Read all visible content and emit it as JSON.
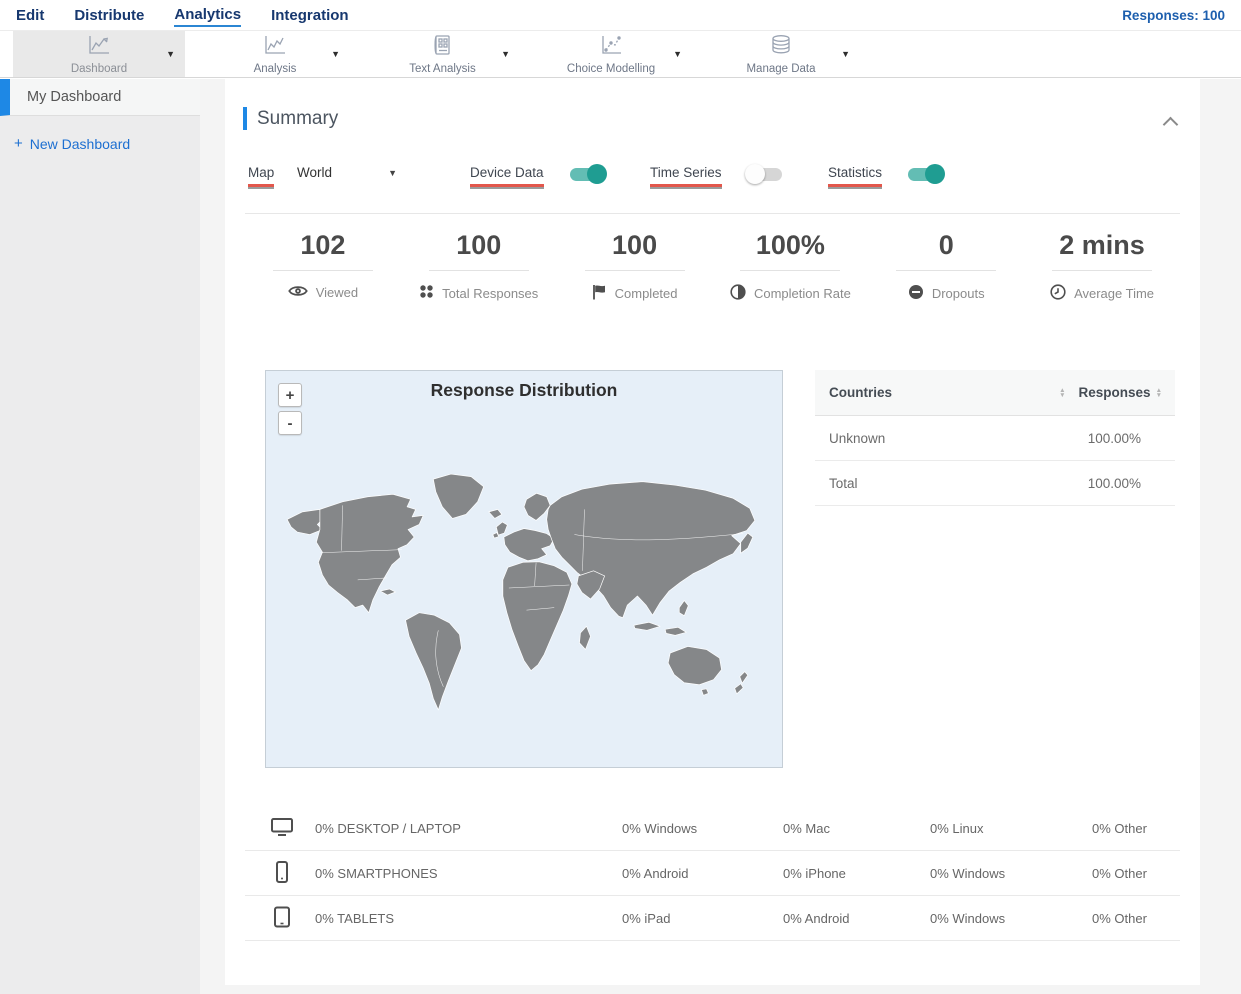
{
  "colors": {
    "accent_blue": "#1e88e5",
    "nav_text": "#17386f",
    "nav_underline": "#2b86d3",
    "link_blue": "#1d6fd1",
    "toggle_on_teal": "#26a69a",
    "label_underline_red": "#e2574c",
    "map_background": "#e6eff8",
    "map_country_fill": "#858789"
  },
  "top_nav": {
    "items": [
      {
        "label": "Edit",
        "active": false
      },
      {
        "label": "Distribute",
        "active": false
      },
      {
        "label": "Analytics",
        "active": true
      },
      {
        "label": "Integration",
        "active": false
      }
    ],
    "responses_label": "Responses: 100"
  },
  "toolbar": {
    "items": [
      {
        "label": "Dashboard",
        "icon": "line-chart-icon",
        "active": true
      },
      {
        "label": "Analysis",
        "icon": "line-chart-icon",
        "active": false
      },
      {
        "label": "Text Analysis",
        "icon": "document-grid-icon",
        "active": false
      },
      {
        "label": "Choice Modelling",
        "icon": "scatter-chart-icon",
        "active": false
      },
      {
        "label": "Manage Data",
        "icon": "database-icon",
        "active": false
      }
    ]
  },
  "sidebar": {
    "items": [
      {
        "label": "My Dashboard",
        "active": true
      }
    ],
    "new_dashboard": {
      "plus": "+",
      "label": "New Dashboard"
    }
  },
  "summary": {
    "title": "Summary",
    "controls": {
      "map_label": "Map",
      "map_region": "World",
      "toggles": [
        {
          "label": "Device Data",
          "on": true
        },
        {
          "label": "Time Series",
          "on": false
        },
        {
          "label": "Statistics",
          "on": true
        }
      ]
    },
    "stats": [
      {
        "value": "102",
        "label": "Viewed",
        "icon": "eye-icon"
      },
      {
        "value": "100",
        "label": "Total Responses",
        "icon": "dots-grid-icon"
      },
      {
        "value": "100",
        "label": "Completed",
        "icon": "flag-icon"
      },
      {
        "value": "100%",
        "label": "Completion Rate",
        "icon": "half-circle-icon"
      },
      {
        "value": "0",
        "label": "Dropouts",
        "icon": "minus-circle-icon"
      },
      {
        "value": "2 mins",
        "label": "Average Time",
        "icon": "clock-icon"
      }
    ],
    "map": {
      "title": "Response Distribution",
      "zoom_in_label": "+",
      "zoom_out_label": "-"
    },
    "countries_table": {
      "headers": {
        "countries": "Countries",
        "responses": "Responses"
      },
      "rows": [
        {
          "country": "Unknown",
          "responses": "100.00%"
        },
        {
          "country": "Total",
          "responses": "100.00%"
        }
      ]
    },
    "device_rows": [
      {
        "icon": "desktop-icon",
        "label": "0% DESKTOP / LAPTOP",
        "cols": [
          "0% Windows",
          "0% Mac",
          "0% Linux",
          "0% Other"
        ]
      },
      {
        "icon": "smartphone-icon",
        "label": "0% SMARTPHONES",
        "cols": [
          "0% Android",
          "0% iPhone",
          "0% Windows",
          "0% Other"
        ]
      },
      {
        "icon": "tablet-icon",
        "label": "0% TABLETS",
        "cols": [
          "0% iPad",
          "0% Android",
          "0% Windows",
          "0% Other"
        ]
      }
    ]
  }
}
